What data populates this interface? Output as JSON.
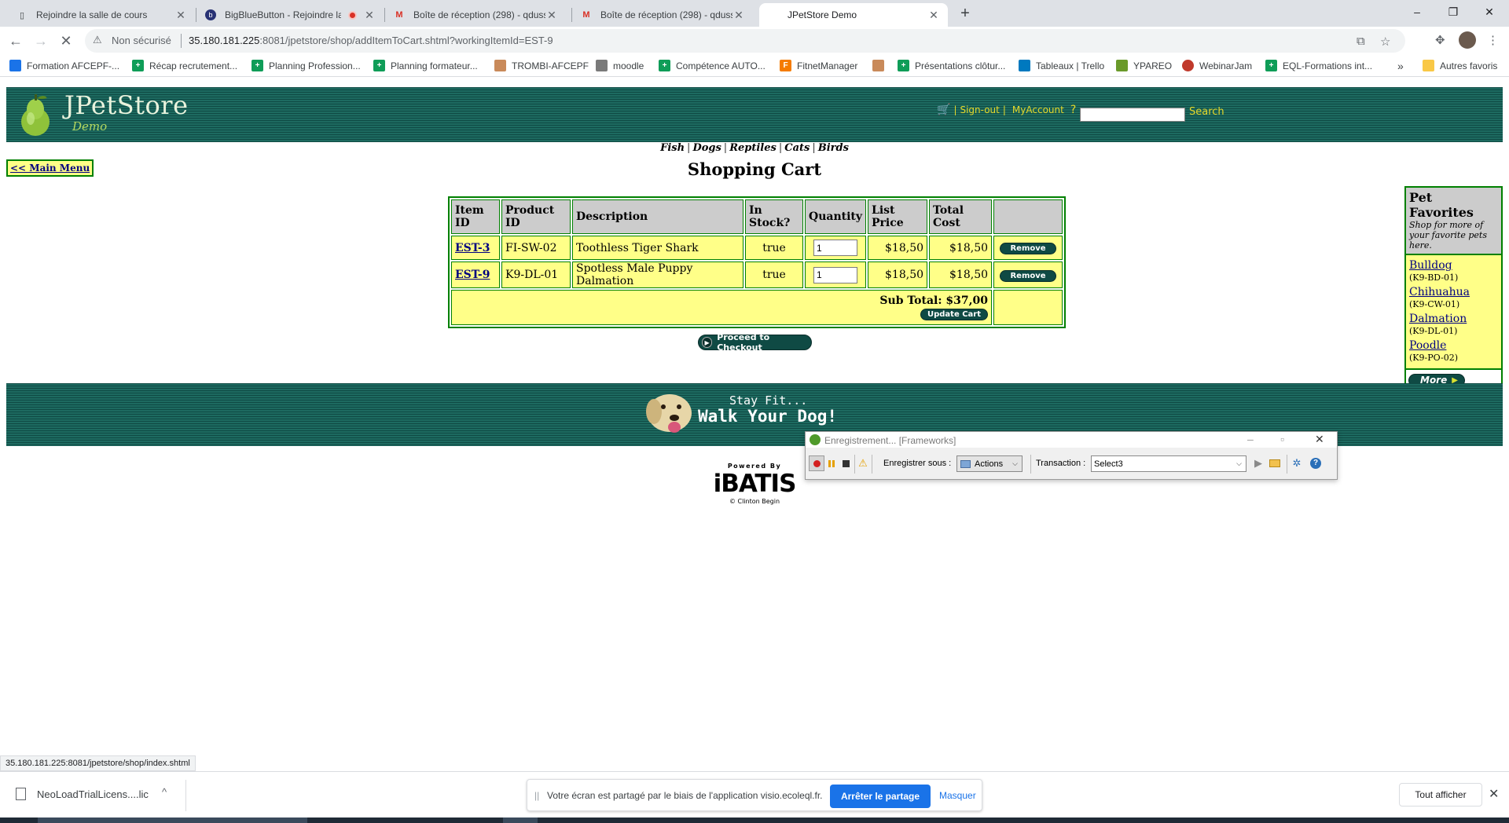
{
  "browser": {
    "tabs": [
      {
        "title": "Rejoindre la salle de cours",
        "icon": "page-icon"
      },
      {
        "title": "BigBlueButton - Rejoindre la",
        "icon": "bigbluebutton-icon",
        "recording": true
      },
      {
        "title": "Boîte de réception (298) - qdusse",
        "icon": "gmail-icon"
      },
      {
        "title": "Boîte de réception (298) - qdusse",
        "icon": "gmail-icon"
      },
      {
        "title": "JPetStore Demo",
        "icon": "loading-icon",
        "active": true
      }
    ],
    "new_tab": "+",
    "window_controls": [
      "–",
      "❐",
      "✕"
    ],
    "security_label": "Non sécurisé",
    "url_host": "35.180.181.225",
    "url_rest": ":8081/jpetstore/shop/addItemToCart.shtml?workingItemId=EST-9",
    "bookmarks": [
      {
        "label": "Formation AFCEPF-...",
        "color": "#1a73e8"
      },
      {
        "label": "Récap recrutement...",
        "color": "#0f9d58"
      },
      {
        "label": "Planning Profession...",
        "color": "#0f9d58"
      },
      {
        "label": "Planning formateur...",
        "color": "#0f9d58"
      },
      {
        "label": "TROMBI-AFCEPF",
        "color": "#c98a5a"
      },
      {
        "label": "moodle",
        "color": "#7a7a7a"
      },
      {
        "label": "Compétence AUTO...",
        "color": "#0f9d58"
      },
      {
        "label": "FitnetManager",
        "color": "#f57c00"
      },
      {
        "label": "Présentations clôtur...",
        "color": "#0f9d58"
      },
      {
        "label": "Tableaux | Trello",
        "color": "#0079bf"
      },
      {
        "label": "YPAREO",
        "color": "#6a9a2a"
      },
      {
        "label": "WebinarJam",
        "color": "#c0392b"
      },
      {
        "label": "EQL-Formations int...",
        "color": "#0f9d58"
      }
    ],
    "bookmarks_overflow": "»",
    "other_bookmarks": "Autres favoris"
  },
  "store": {
    "logo_text": "JPetStore",
    "logo_sub": "Demo",
    "sign_out": "Sign-out",
    "my_account": "MyAccount",
    "help": "?",
    "search_label": "Search",
    "categories": [
      "Fish",
      "Dogs",
      "Reptiles",
      "Cats",
      "Birds"
    ],
    "main_menu": "<< Main Menu",
    "cart_title": "Shopping Cart",
    "table_headers": [
      "Item ID",
      "Product ID",
      "Description",
      "In Stock?",
      "Quantity",
      "List Price",
      "Total Cost",
      ""
    ],
    "items": [
      {
        "item_id": "EST-3",
        "product_id": "FI-SW-02",
        "description": "Toothless Tiger Shark",
        "in_stock": "true",
        "quantity": "1",
        "list_price": "$18,50",
        "total_cost": "$18,50",
        "remove": "Remove"
      },
      {
        "item_id": "EST-9",
        "product_id": "K9-DL-01",
        "description": "Spotless Male Puppy Dalmation",
        "in_stock": "true",
        "quantity": "1",
        "list_price": "$18,50",
        "total_cost": "$18,50",
        "remove": "Remove"
      }
    ],
    "subtotal": "Sub Total: $37,00",
    "update_cart": "Update Cart",
    "checkout": "Proceed to Checkout",
    "favorites": {
      "title": "Pet Favorites",
      "subtitle": "Shop for more of your favorite pets here.",
      "pets": [
        {
          "name": "Bulldog",
          "id": "(K9-BD-01)"
        },
        {
          "name": "Chihuahua",
          "id": "(K9-CW-01)"
        },
        {
          "name": "Dalmation",
          "id": "(K9-DL-01)"
        },
        {
          "name": "Poodle",
          "id": "(K9-PO-02)"
        }
      ],
      "more": "More"
    },
    "banner_line1": "Stay Fit...",
    "banner_line2": "Walk Your Dog!",
    "powered_by": "Powered By",
    "ibatis": "iBATIS",
    "credit": "© Clinton Begin"
  },
  "recorder": {
    "title": "Enregistrement... [Frameworks]",
    "save_as_label": "Enregistrer sous :",
    "actions_value": "Actions",
    "transaction_label": "Transaction :",
    "transaction_value": "Select3"
  },
  "status_url": "35.180.181.225:8081/jpetstore/shop/index.shtml",
  "download": {
    "file": "NeoLoadTrialLicens....lic",
    "share_text": "Votre écran est partagé par le biais de l'application visio.ecoleql.fr.",
    "stop_share": "Arrêter le partage",
    "hide": "Masquer",
    "show_all": "Tout afficher"
  }
}
